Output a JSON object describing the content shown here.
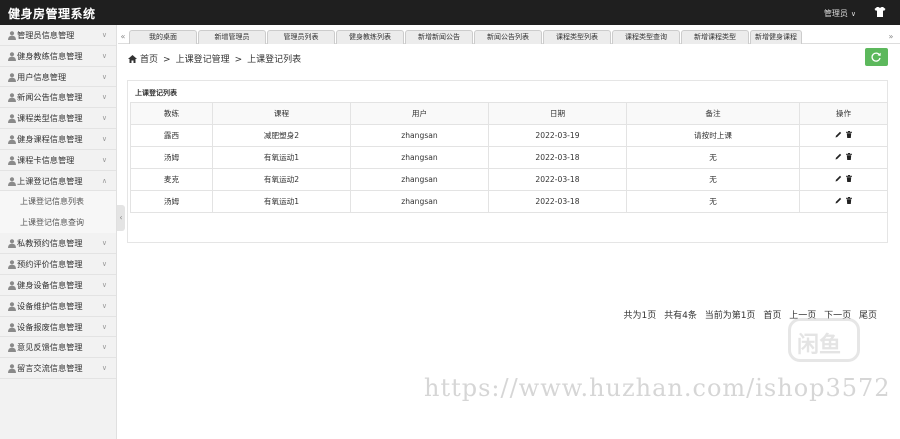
{
  "app": {
    "title": "健身房管理系统",
    "user": "管理员"
  },
  "sidebar": {
    "items": [
      {
        "label": "管理员信息管理"
      },
      {
        "label": "健身教练信息管理"
      },
      {
        "label": "用户信息管理"
      },
      {
        "label": "新闻公告信息管理"
      },
      {
        "label": "课程类型信息管理"
      },
      {
        "label": "健身课程信息管理"
      },
      {
        "label": "课程卡信息管理"
      },
      {
        "label": "上课登记信息管理"
      },
      {
        "label": "私教预约信息管理"
      },
      {
        "label": "预约评价信息管理"
      },
      {
        "label": "健身设备信息管理"
      },
      {
        "label": "设备维护信息管理"
      },
      {
        "label": "设备报废信息管理"
      },
      {
        "label": "意见反馈信息管理"
      },
      {
        "label": "留言交流信息管理"
      }
    ],
    "sub_items": [
      {
        "label": "上课登记信息列表"
      },
      {
        "label": "上课登记信息查询"
      }
    ]
  },
  "tabs": [
    {
      "label": "我的桌面"
    },
    {
      "label": "新增管理员"
    },
    {
      "label": "管理员列表"
    },
    {
      "label": "健身教练列表"
    },
    {
      "label": "新增新闻公告"
    },
    {
      "label": "新闻公告列表"
    },
    {
      "label": "课程类型列表"
    },
    {
      "label": "课程类型查询"
    },
    {
      "label": "新增课程类型"
    },
    {
      "label": "新增健身课程"
    }
  ],
  "breadcrumb": {
    "home": "首页",
    "parent": "上课登记管理",
    "current": "上课登记列表"
  },
  "panel": {
    "title": "上课登记列表"
  },
  "table": {
    "headers": [
      "教练",
      "课程",
      "用户",
      "日期",
      "备注",
      "操作"
    ],
    "rows": [
      [
        "露西",
        "减肥塑身2",
        "zhangsan",
        "2022-03-19",
        "请按时上课"
      ],
      [
        "汤姆",
        "有氧运动1",
        "zhangsan",
        "2022-03-18",
        "无"
      ],
      [
        "麦克",
        "有氧运动2",
        "zhangsan",
        "2022-03-18",
        "无"
      ],
      [
        "汤姆",
        "有氧运动1",
        "zhangsan",
        "2022-03-18",
        "无"
      ]
    ]
  },
  "pager": {
    "total_pages": "共为1页",
    "total_count": "共有4条",
    "current": "当前为第1页",
    "first": "首页",
    "prev": "上一页",
    "next": "下一页",
    "last": "尾页"
  },
  "watermark": {
    "logo": "闲鱼",
    "text": "https://www.huzhan.com/ishop3572"
  },
  "colors": {
    "topbar": "#1f1f1f",
    "refresh": "#5cb85c",
    "sidebar_bg": "#f2f2f2"
  }
}
